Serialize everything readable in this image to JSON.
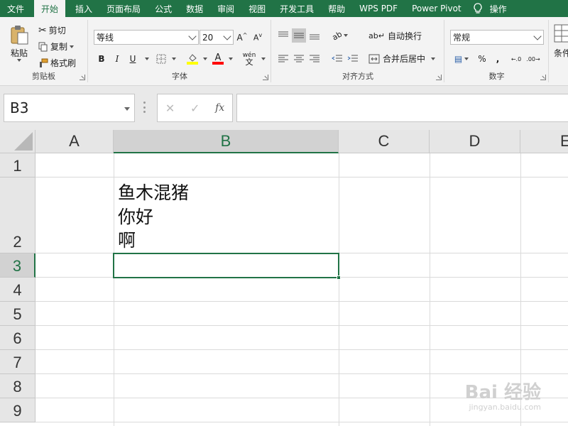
{
  "menu": {
    "tabs": [
      "文件",
      "开始",
      "插入",
      "页面布局",
      "公式",
      "数据",
      "审阅",
      "视图",
      "开发工具",
      "帮助",
      "WPS PDF",
      "Power Pivot",
      "操作"
    ],
    "active": "开始"
  },
  "ribbon": {
    "clipboard": {
      "paste": "粘贴",
      "cut": "剪切",
      "copy": "复制",
      "format_painter": "格式刷",
      "label": "剪贴板"
    },
    "font": {
      "name": "等线",
      "size": "20",
      "bold": "B",
      "italic": "I",
      "underline": "U",
      "phonetic": "wén",
      "label": "字体",
      "fill_color": "#ffff00",
      "font_color": "#ff0000"
    },
    "alignment": {
      "wrap": "自动换行",
      "merge": "合并后居中",
      "label": "对齐方式"
    },
    "number": {
      "format": "常规",
      "percent": "%",
      "comma": ",",
      "label": "数字"
    },
    "styles": {
      "conditional": "条件"
    }
  },
  "formula_bar": {
    "name_box": "B3",
    "cancel": "✕",
    "enter": "✓",
    "fx": "fx",
    "content": ""
  },
  "sheet": {
    "columns": [
      "A",
      "B",
      "C",
      "D",
      "E"
    ],
    "selected_column": "B",
    "rows": [
      "1",
      "2",
      "3",
      "4",
      "5",
      "6",
      "7",
      "8",
      "9"
    ],
    "selected_row": "3",
    "cells": {
      "B2": "鱼木混猪\n你好\n啊"
    }
  },
  "watermark": {
    "main": "Bai 经验",
    "sub": "jingyan.baidu.com"
  },
  "colors": {
    "accent": "#217346"
  }
}
